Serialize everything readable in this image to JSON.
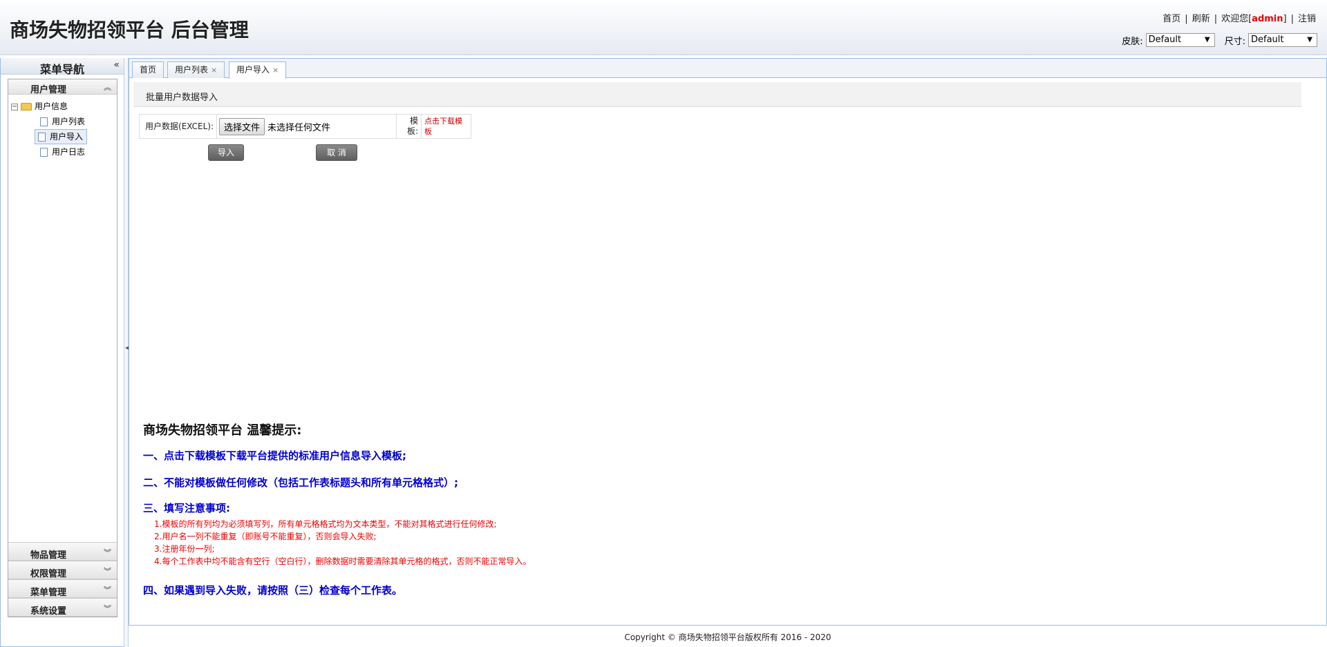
{
  "header": {
    "app_title": "商场失物招领平台 后台管理",
    "links": {
      "home": "首页",
      "refresh": "刷新",
      "welcome_prefix": "欢迎您[",
      "username": "admin",
      "welcome_suffix": "]",
      "logout": "注销",
      "separator": "|"
    },
    "skin_label": "皮肤:",
    "skin_value": "Default",
    "size_label": "尺寸:",
    "size_value": "Default"
  },
  "sidebar": {
    "title": "菜单导航",
    "collapse_icon": "«",
    "sections": {
      "user_mgmt": "用户管理",
      "goods_mgmt": "物品管理",
      "perm_mgmt": "权限管理",
      "menu_mgmt": "菜单管理",
      "sys_settings": "系统设置"
    },
    "tree": {
      "folder": "用户信息",
      "items": [
        "用户列表",
        "用户导入",
        "用户日志"
      ]
    }
  },
  "tabs": {
    "home": "首页",
    "user_list": "用户列表",
    "user_import": "用户导入",
    "close": "×"
  },
  "page": {
    "heading": "批量用户数据导入",
    "field_label": "用户数据(EXCEL):",
    "file_button": "选择文件",
    "file_status": "未选择任何文件",
    "template_label": "模板:",
    "template_link": "点击下载模板",
    "import_button": "导入",
    "cancel_button": "取  消"
  },
  "tips": {
    "title": "商场失物招领平台 温馨提示:",
    "tip1": "一、点击下载模板下载平台提供的标准用户信息导入模板;",
    "tip2": "二、不能对模板做任何修改（包括工作表标题头和所有单元格格式）;",
    "tip3": "三、填写注意事项:",
    "subtips": [
      "1.模板的所有列均为必须填写列，所有单元格格式均为文本类型，不能对其格式进行任何修改;",
      "2.用户名一列不能重复（即账号不能重复），否则会导入失败;",
      "3.注册年份一列;",
      "4.每个工作表中均不能含有空行（空白行），删除数据时需要清除其单元格的格式，否则不能正常导入。"
    ],
    "tip4": "四、如果遇到导入失败，请按照（三）检查每个工作表。"
  },
  "footer": "Copyright © 商场失物招领平台版权所有  2016 - 2020"
}
